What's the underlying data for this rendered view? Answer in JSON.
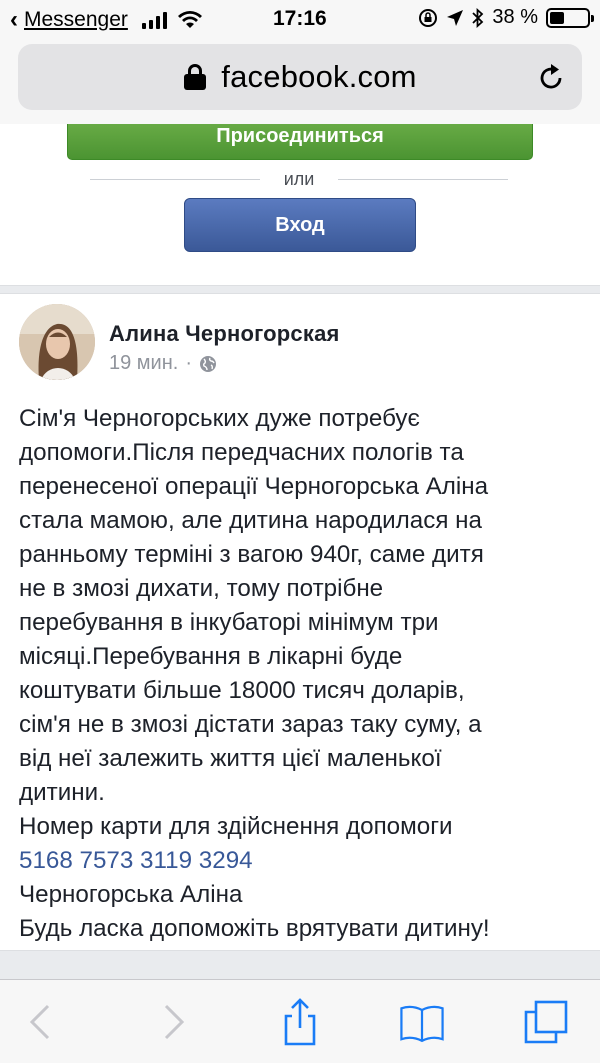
{
  "status_bar": {
    "back_app": "Messenger",
    "time": "17:16",
    "battery": "38 %",
    "battery_level": 0.38
  },
  "browser": {
    "url": "facebook.com"
  },
  "login_card": {
    "join_label": "Присоединиться",
    "or_label": "или",
    "login_label": "Вход"
  },
  "post": {
    "author": "Алина Черногорская",
    "time": "19 мин.",
    "separator": "·",
    "lines": [
      "Сім'я Черногорських дуже потребує",
      "допомоги.Після передчасних пологів та",
      "перенесеної операції Черногорська Аліна",
      "стала мамою, але дитина народилася на",
      "ранньому терміні з вагою 940г, саме дитя",
      "не в змозі дихати, тому потрібне",
      "перебування в інкубаторі мінімум три",
      "місяці.Перебування в лікарні буде",
      "коштувати більше 18000 тисяч доларів,",
      "сім'я не в змозі дістати зараз таку суму, а",
      "від неї залежить життя цієї маленької",
      "дитини.",
      "Номер карти для здійснення допомоги"
    ],
    "card_number": "5168 7573 3119 3294",
    "closing_lines": [
      "Черногорська Аліна",
      "Будь ласка допоможіть врятувати дитину!"
    ]
  },
  "colors": {
    "facebook_blue": "#3b5998",
    "join_green": "#4b9432",
    "link_blue": "#385898"
  }
}
